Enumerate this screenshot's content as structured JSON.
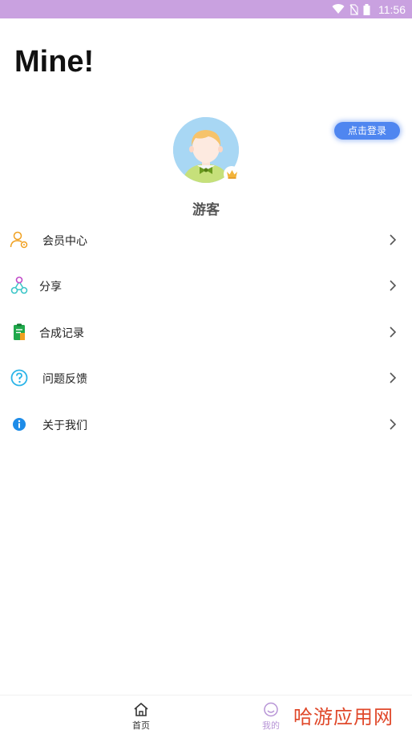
{
  "status_bar": {
    "time": "11:56"
  },
  "header": {
    "title": "Mine!"
  },
  "profile": {
    "login_button": "点击登录",
    "username": "游客"
  },
  "menu": [
    {
      "label": "会员中心",
      "icon": "member-center-icon",
      "color": "#f0a020"
    },
    {
      "label": "分享",
      "icon": "share-icon",
      "color": "#3cc6c8"
    },
    {
      "label": "合成记录",
      "icon": "clipboard-record-icon",
      "color": "#1fa84a"
    },
    {
      "label": "问题反馈",
      "icon": "question-icon",
      "color": "#2ab4e8"
    },
    {
      "label": "关于我们",
      "icon": "info-icon",
      "color": "#1e8ce8"
    }
  ],
  "tabbar": {
    "tabs": [
      {
        "label": "首页",
        "icon": "home-icon",
        "active": false
      },
      {
        "label": "我的",
        "icon": "smile-icon",
        "active": true
      }
    ]
  },
  "watermark": "哈游应用网",
  "colors": {
    "status_bar": "#c9a1e0",
    "accent_blue": "#4f86f0",
    "active_tab": "#b794d6",
    "watermark": "#e0492b"
  }
}
